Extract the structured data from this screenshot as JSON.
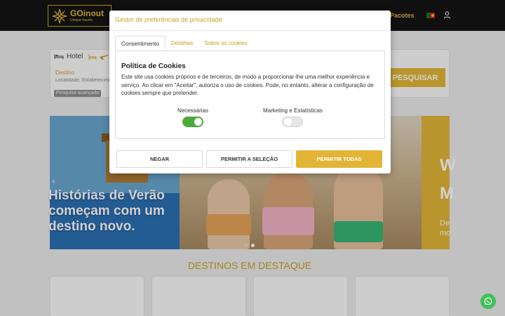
{
  "header": {
    "brand_name": "GOinout",
    "brand_tagline": "Unique travels",
    "nav_pacotes": "Pacotes",
    "language_flag": "portugal-flag",
    "accent_color": "#e3b536"
  },
  "search": {
    "tab_hotel": "Hotel",
    "destino_label": "Destino",
    "destino_placeholder": "Localidade, Estabelecimento",
    "advanced_search": "Pesquisa avançada",
    "search_button": "PESQUISAR"
  },
  "banner": {
    "headline_line1": "Histórias de Verão",
    "headline_line2": "começam com um",
    "headline_line3": "destino novo.",
    "right_big1": "W",
    "right_big2": "M",
    "right_small1": "De",
    "right_small2": "mo",
    "prev_arrow": "‹",
    "dots_count": 2,
    "active_dot": 1
  },
  "destinos": {
    "title": "DESTINOS EM DESTAQUE"
  },
  "cookie_modal": {
    "title": "Gestor de preferências de privacidade",
    "tabs": [
      {
        "label": "Consentimento",
        "active": true
      },
      {
        "label": "Detalhes",
        "active": false
      },
      {
        "label": "Sobre os cookies",
        "active": false
      }
    ],
    "policy_title": "Política de Cookies",
    "policy_text": "Este site usa cookies próprios e de terceiros, de modo a proporcionar-lhe uma melhor experiência e serviço. Ao clicar em \"Aceitar\", autoriza o uso de cookies. Pode, no entanto, alterar a configuração de cookies sempre que pretender.",
    "toggles": [
      {
        "label": "Necessárias",
        "on": true
      },
      {
        "label": "Marketing e Estatísticas",
        "on": false
      }
    ],
    "buttons": {
      "deny": "NEGAR",
      "allow_selection": "PERMITIR A SELEÇÃO",
      "allow_all": "PERMITIR TODAS"
    }
  }
}
